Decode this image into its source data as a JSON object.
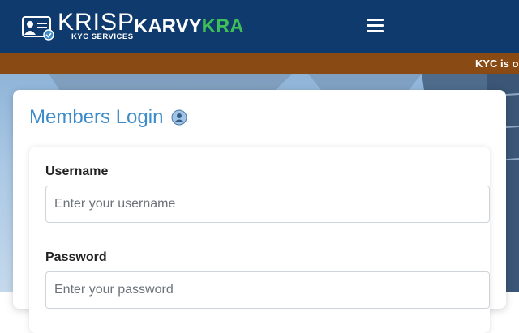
{
  "header": {
    "logo_word": "KRISP",
    "logo_sub": "KYC SERVICES",
    "brand_part1": "KARVY",
    "brand_part2": "KRA",
    "brand_color_primary": "#0f3a6e",
    "brand_color_accent": "#3fbf57",
    "menu_icon": "hamburger-menu-icon"
  },
  "ticker": {
    "text": "KYC is o",
    "color": "#8a4a14"
  },
  "login": {
    "title": "Members Login",
    "title_icon": "user-avatar-icon",
    "title_color": "#3d8cc9",
    "username_label": "Username",
    "username_placeholder": "Enter your username",
    "password_label": "Password",
    "password_placeholder": "Enter your password"
  }
}
